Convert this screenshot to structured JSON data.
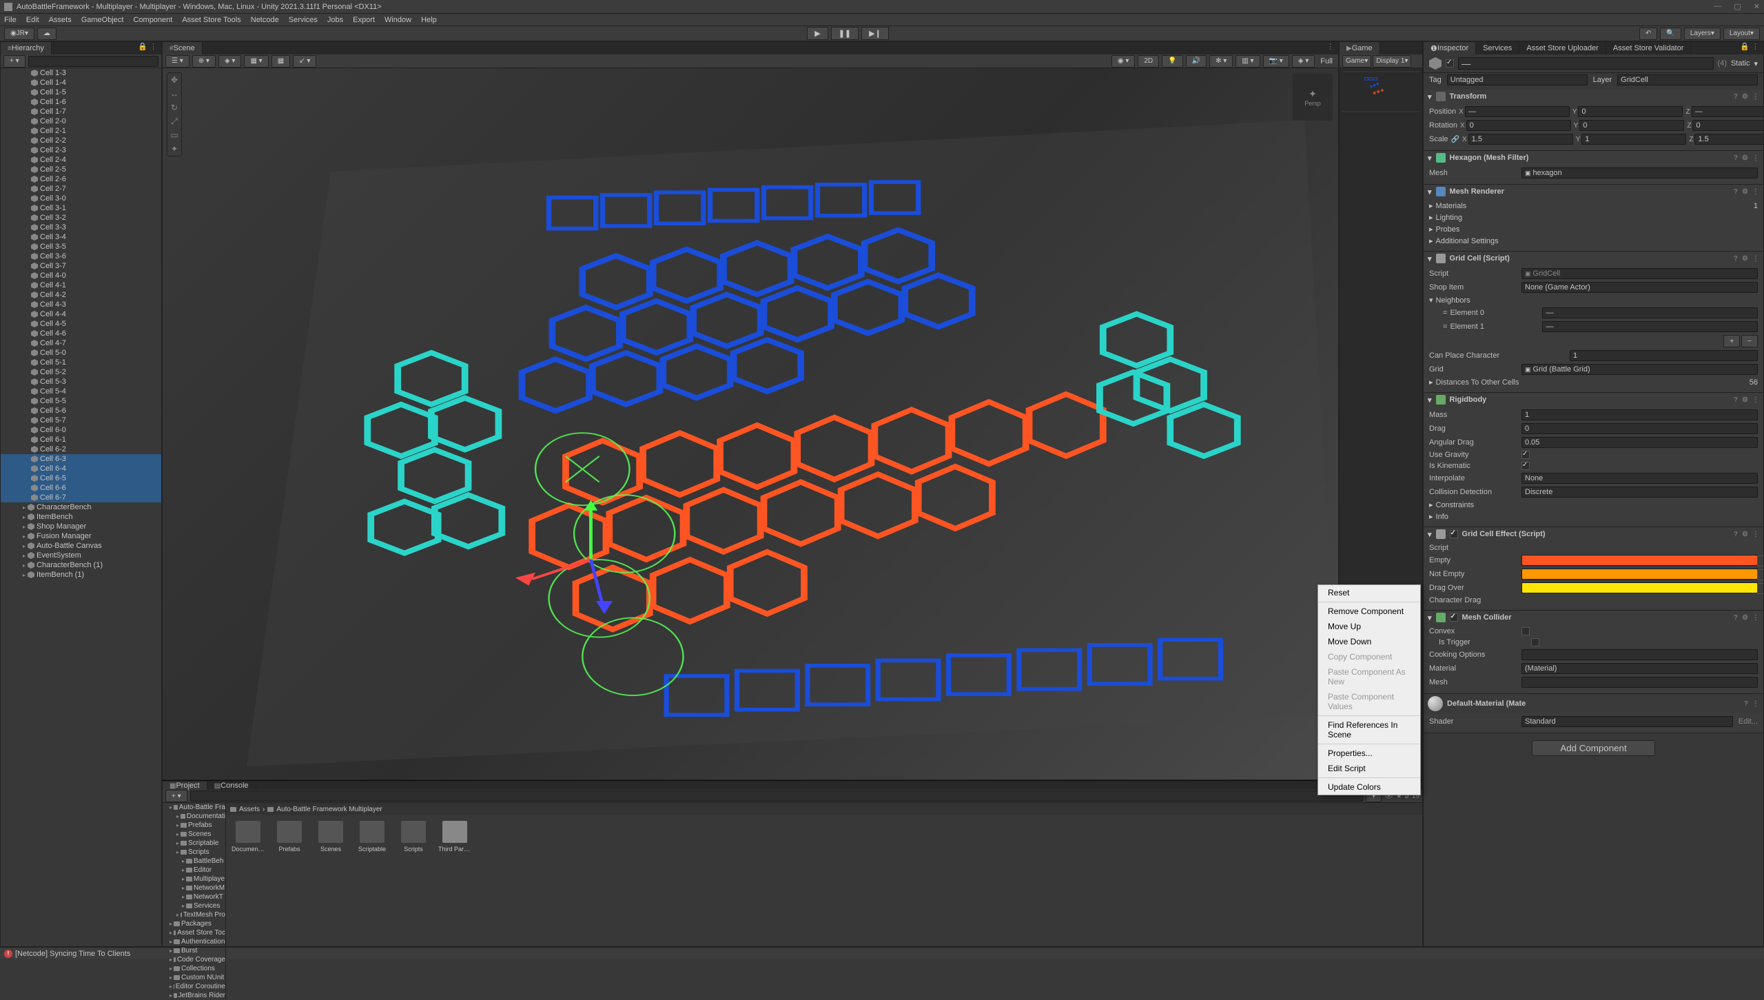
{
  "titlebar": {
    "title": "AutoBattleFramework - Multiplayer - Multiplayer - Windows, Mac, Linux - Unity 2021.3.11f1 Personal <DX11>"
  },
  "menubar": [
    "File",
    "Edit",
    "Assets",
    "GameObject",
    "Component",
    "Asset Store Tools",
    "Netcode",
    "Services",
    "Jobs",
    "Export",
    "Window",
    "Help"
  ],
  "toolbar": {
    "account": "JR",
    "right": {
      "layers": "Layers",
      "layout": "Layout"
    }
  },
  "hierarchy": {
    "tab": "Hierarchy",
    "items": [
      "Cell 1-3",
      "Cell 1-4",
      "Cell 1-5",
      "Cell 1-6",
      "Cell 1-7",
      "Cell 2-0",
      "Cell 2-1",
      "Cell 2-2",
      "Cell 2-3",
      "Cell 2-4",
      "Cell 2-5",
      "Cell 2-6",
      "Cell 2-7",
      "Cell 3-0",
      "Cell 3-1",
      "Cell 3-2",
      "Cell 3-3",
      "Cell 3-4",
      "Cell 3-5",
      "Cell 3-6",
      "Cell 3-7",
      "Cell 4-0",
      "Cell 4-1",
      "Cell 4-2",
      "Cell 4-3",
      "Cell 4-4",
      "Cell 4-5",
      "Cell 4-6",
      "Cell 4-7",
      "Cell 5-0",
      "Cell 5-1",
      "Cell 5-2",
      "Cell 5-3",
      "Cell 5-4",
      "Cell 5-5",
      "Cell 5-6",
      "Cell 5-7",
      "Cell 6-0",
      "Cell 6-1",
      "Cell 6-2",
      "Cell 6-3",
      "Cell 6-4",
      "Cell 6-5",
      "Cell 6-6",
      "Cell 6-7"
    ],
    "selected": [
      "Cell 6-3",
      "Cell 6-4",
      "Cell 6-5",
      "Cell 6-6",
      "Cell 6-7"
    ],
    "others": [
      "CharacterBench",
      "ItemBench",
      "Shop Manager",
      "Fusion Manager",
      "Auto-Battle Canvas",
      "EventSystem",
      "CharacterBench (1)",
      "ItemBench (1)"
    ]
  },
  "scene": {
    "tab": "Scene",
    "toolbar_left": [
      "2D"
    ],
    "toolbar_right": [
      "Full"
    ],
    "gizmo": "Persp"
  },
  "game": {
    "tab": "Game",
    "toolbar": {
      "target": "Game",
      "display": "Display 1"
    }
  },
  "project": {
    "tabs": [
      "Project",
      "Console"
    ],
    "active_tab": "Project",
    "breadcrumb": [
      "Assets",
      "Auto-Battle Framework Multiplayer"
    ],
    "tree": [
      "Auto-Battle Fra",
      "Documentati",
      "Prefabs",
      "Scenes",
      "Scriptable",
      "Scripts",
      "BattleBeh",
      "Editor",
      "Multiplaye",
      "NetworkM",
      "NetworkT",
      "Services",
      "TextMesh Pro",
      "Packages",
      "Asset Store Toc",
      "Authentication",
      "Burst",
      "Code Coverage",
      "Collections",
      "Custom NUnit",
      "Editor Coroutine",
      "JetBrains Rider"
    ],
    "assets": [
      {
        "name": "Document...",
        "type": "folder"
      },
      {
        "name": "Prefabs",
        "type": "folder"
      },
      {
        "name": "Scenes",
        "type": "folder"
      },
      {
        "name": "Scriptable",
        "type": "folder"
      },
      {
        "name": "Scripts",
        "type": "folder"
      },
      {
        "name": "Third Party...",
        "type": "doc"
      }
    ],
    "footer_count": "19"
  },
  "inspector": {
    "tabs": [
      "Inspector",
      "Services",
      "Asset Store Uploader",
      "Asset Store Validator"
    ],
    "active_tab": "Inspector",
    "obj_name": "—",
    "static_label": "Static",
    "multi_count": "(4)",
    "tag": {
      "label": "Tag",
      "value": "Untagged"
    },
    "layer": {
      "label": "Layer",
      "value": "GridCell"
    },
    "transform": {
      "title": "Transform",
      "position": {
        "label": "Position",
        "x": "—",
        "y": "0",
        "z": "—"
      },
      "rotation": {
        "label": "Rotation",
        "x": "0",
        "y": "0",
        "z": "0"
      },
      "scale": {
        "label": "Scale",
        "x": "1.5",
        "y": "1",
        "z": "1.5"
      }
    },
    "mesh_filter": {
      "title": "Hexagon (Mesh Filter)",
      "mesh_label": "Mesh",
      "mesh_value": "hexagon"
    },
    "mesh_renderer": {
      "title": "Mesh Renderer",
      "items": [
        "Materials",
        "Lighting",
        "Probes",
        "Additional Settings"
      ],
      "materials_count": "1"
    },
    "grid_cell": {
      "title": "Grid Cell (Script)",
      "script_label": "Script",
      "script_value": "GridCell",
      "shop_item_label": "Shop Item",
      "shop_item_value": "None (Game Actor)",
      "neighbors_label": "Neighbors",
      "elements": [
        "Element 0",
        "Element 1"
      ],
      "element_value": "—",
      "can_place_label": "Can Place Character",
      "can_place_value": "1",
      "grid_label": "Grid",
      "grid_value": "Grid (Battle Grid)",
      "distances_label": "Distances To Other Cells",
      "distances_value": "56"
    },
    "rigidbody": {
      "title": "Rigidbody",
      "mass": {
        "label": "Mass",
        "value": "1"
      },
      "drag": {
        "label": "Drag",
        "value": "0"
      },
      "angular_drag": {
        "label": "Angular Drag",
        "value": "0.05"
      },
      "use_gravity": {
        "label": "Use Gravity",
        "checked": true
      },
      "is_kinematic": {
        "label": "Is Kinematic",
        "checked": true
      },
      "interpolate": {
        "label": "Interpolate",
        "value": "None"
      },
      "collision": {
        "label": "Collision Detection",
        "value": "Discrete"
      },
      "constraints": "Constraints",
      "info": "Info"
    },
    "grid_cell_effect": {
      "title": "Grid Cell Effect (Script)",
      "script_label": "Script",
      "empty_label": "Empty",
      "not_empty_label": "Not Empty",
      "drag_over_label": "Drag Over",
      "char_drag_label": "Character Drag",
      "empty_color": "#ff5522",
      "not_empty_color": "#ff9800",
      "drag_over_color": "#ffe600"
    },
    "mesh_collider": {
      "title": "Mesh Collider",
      "convex": "Convex",
      "is_trigger": "Is Trigger",
      "cooking": "Cooking Options",
      "material_label": "Material",
      "material_value": "(Material)",
      "mesh_label": "Mesh"
    },
    "default_material": {
      "title": "Default-Material (Mate",
      "shader_label": "Shader",
      "shader_value": "Standard",
      "edit": "Edit..."
    },
    "add_component": "Add Component"
  },
  "context_menu": {
    "items": [
      {
        "label": "Reset",
        "enabled": true
      },
      {
        "sep": true
      },
      {
        "label": "Remove Component",
        "enabled": true
      },
      {
        "label": "Move Up",
        "enabled": true
      },
      {
        "label": "Move Down",
        "enabled": true
      },
      {
        "label": "Copy Component",
        "enabled": false
      },
      {
        "label": "Paste Component As New",
        "enabled": false
      },
      {
        "label": "Paste Component Values",
        "enabled": false
      },
      {
        "sep": true
      },
      {
        "label": "Find References In Scene",
        "enabled": true
      },
      {
        "sep": true
      },
      {
        "label": "Properties...",
        "enabled": true
      },
      {
        "label": "Edit Script",
        "enabled": true
      },
      {
        "sep": true
      },
      {
        "label": "Update Colors",
        "enabled": true
      }
    ]
  },
  "statusbar": {
    "msg": "[Netcode] Syncing Time To Clients"
  }
}
